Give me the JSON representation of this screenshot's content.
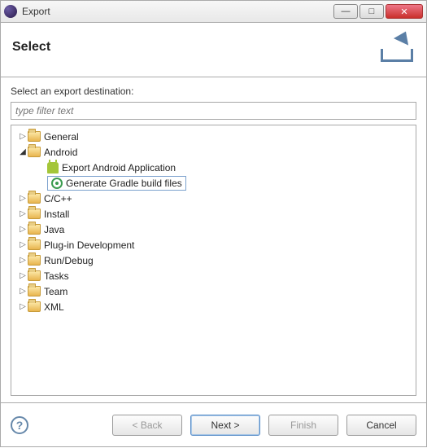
{
  "window": {
    "title": "Export"
  },
  "header": {
    "title": "Select"
  },
  "content": {
    "prompt": "Select an export destination:",
    "filter_placeholder": "type filter text"
  },
  "tree": {
    "general": "General",
    "android": "Android",
    "android_children": {
      "export_app": "Export Android Application",
      "gen_gradle": "Generate Gradle build files"
    },
    "ccpp": "C/C++",
    "install": "Install",
    "java": "Java",
    "plugin": "Plug-in Development",
    "run_debug": "Run/Debug",
    "tasks": "Tasks",
    "team": "Team",
    "xml": "XML"
  },
  "footer": {
    "back": "< Back",
    "next": "Next >",
    "finish": "Finish",
    "cancel": "Cancel"
  }
}
